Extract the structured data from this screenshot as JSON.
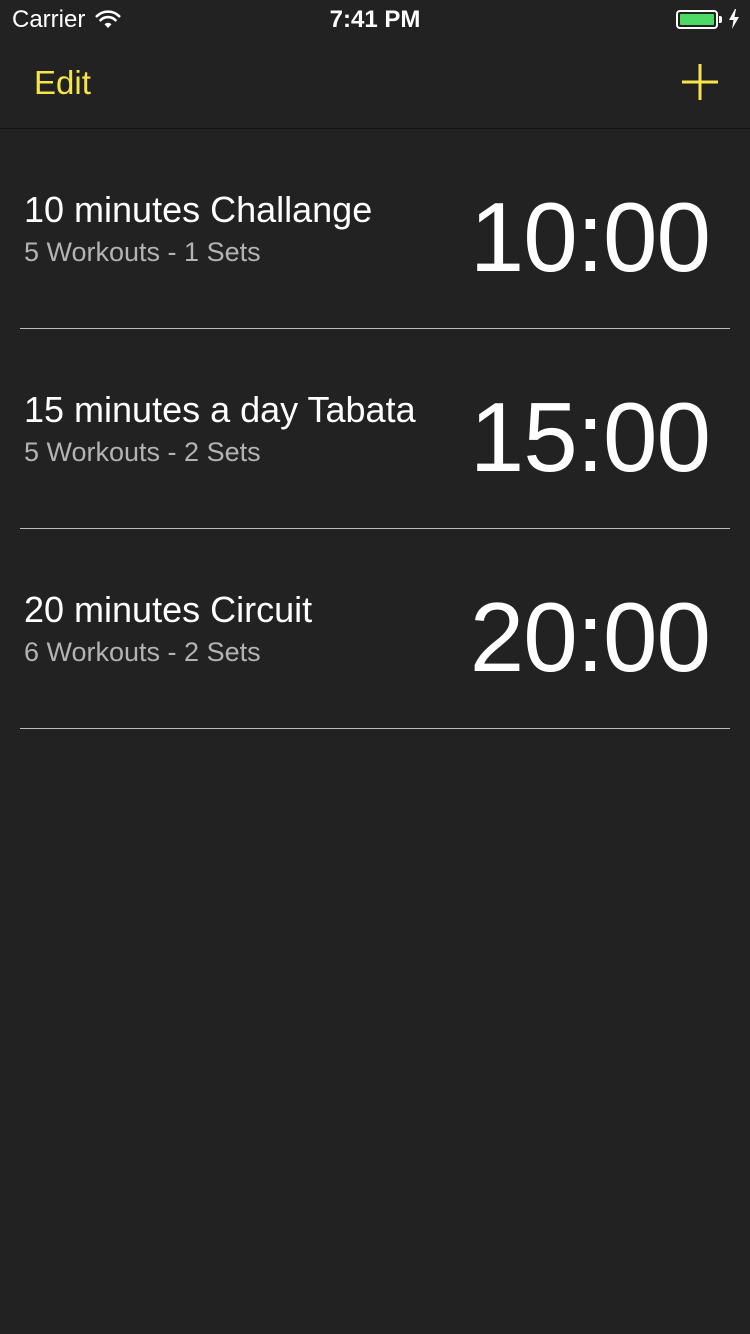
{
  "status_bar": {
    "carrier": "Carrier",
    "time": "7:41 PM",
    "battery_level": 1.0,
    "charging": true,
    "battery_color": "#4cd964"
  },
  "nav": {
    "edit_label": "Edit",
    "add_icon": "plus-icon",
    "accent_color": "#f5e44a"
  },
  "workouts": [
    {
      "title": "10 minutes Challange",
      "subtitle": "5 Workouts - 1 Sets",
      "time": "10:00"
    },
    {
      "title": "15 minutes a day Tabata",
      "subtitle": "5 Workouts - 2 Sets",
      "time": "15:00"
    },
    {
      "title": "20 minutes Circuit",
      "subtitle": "6 Workouts - 2 Sets",
      "time": "20:00"
    }
  ]
}
